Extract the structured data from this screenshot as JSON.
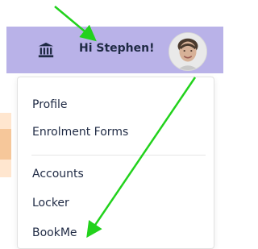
{
  "header": {
    "greeting": "Hi Stephen!",
    "icon": "bank-icon",
    "background_color": "#b9b2e8"
  },
  "menu": {
    "items": [
      {
        "label": "Profile"
      },
      {
        "label": "Enrolment Forms"
      },
      {
        "label": "Accounts"
      },
      {
        "label": "Locker"
      },
      {
        "label": "BookMe"
      }
    ]
  },
  "annotations": {
    "arrow_color": "#22d21c"
  }
}
